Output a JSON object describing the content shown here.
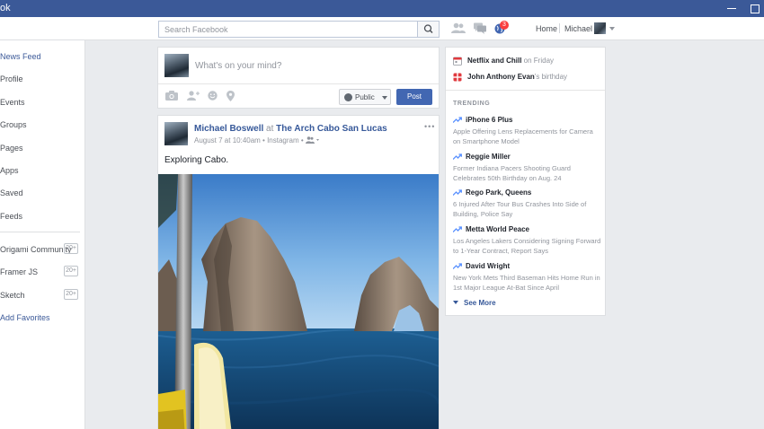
{
  "window": {
    "title": "ok"
  },
  "topnav": {
    "search_placeholder": "Search Facebook",
    "notification_count": "3",
    "home_label": "Home",
    "user_label": "Michael"
  },
  "sidebar": {
    "items": [
      {
        "label": "News Feed"
      },
      {
        "label": "Profile"
      },
      {
        "label": "Events"
      },
      {
        "label": "Groups"
      },
      {
        "label": "Pages"
      },
      {
        "label": "Apps"
      },
      {
        "label": "Saved"
      },
      {
        "label": "Feeds"
      }
    ],
    "favorites": [
      {
        "label": "Origami Community",
        "count": "20+"
      },
      {
        "label": "Framer JS",
        "count": "20+"
      },
      {
        "label": "Sketch",
        "count": "20+"
      }
    ],
    "add_favorites": "Add Favorites"
  },
  "composer": {
    "placeholder": "What's on your mind?",
    "privacy": "Public",
    "post_label": "Post"
  },
  "post": {
    "author": "Michael Boswell",
    "at_word": "at",
    "place": "The Arch Cabo San Lucas",
    "meta": "August 7 at 10:40am • Instagram •",
    "text": "Exploring Cabo."
  },
  "events": {
    "event_name": "Netflix and Chill",
    "event_when": " on Friday",
    "birthday_name": "John Anthony Evan",
    "birthday_suffix": "'s birthday"
  },
  "trending": {
    "heading": "TRENDING",
    "items": [
      {
        "title": "iPhone 6 Plus",
        "desc": "Apple Offering Lens Replacements for Camera on Smartphone Model"
      },
      {
        "title": "Reggie Miller",
        "desc": "Former Indiana Pacers Shooting Guard Celebrates 50th Birthday on Aug. 24"
      },
      {
        "title": "Rego Park, Queens",
        "desc": "6 Injured After Tour Bus Crashes Into Side of Building, Police Say"
      },
      {
        "title": "Metta World Peace",
        "desc": "Los Angeles Lakers Considering Signing Forward to 1-Year Contract, Report Says"
      },
      {
        "title": "David Wright",
        "desc": "New York Mets Third Baseman Hits Home Run in 1st Major League At-Bat Since April"
      }
    ],
    "see_more": "See More"
  },
  "colors": {
    "brand": "#3b5998",
    "link": "#365899",
    "button": "#4267b2",
    "trend_arrow": "#5890ff",
    "badge": "#fa3e3e"
  },
  "icons": [
    "search-icon",
    "friends-icon",
    "messages-icon",
    "globe-notifications-icon",
    "camera-icon",
    "tag-friends-icon",
    "feeling-icon",
    "location-icon",
    "calendar-icon",
    "gift-icon",
    "trending-arrow-icon"
  ]
}
